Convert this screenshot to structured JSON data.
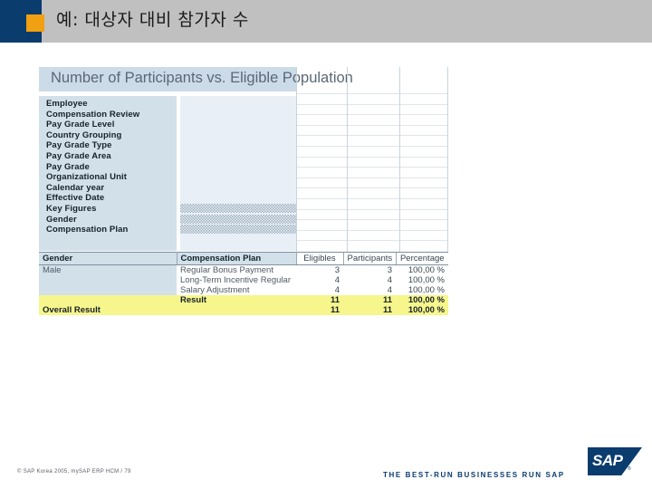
{
  "slide": {
    "title": "예: 대상자 대비 참가자 수",
    "accent_blue": "#0a3c6e",
    "accent_orange": "#f0a010",
    "header_bg": "#c0c0c0"
  },
  "report": {
    "title": "Number of Participants vs. Eligible Population",
    "filters": [
      {
        "label": "Employee",
        "hatched": false
      },
      {
        "label": "Compensation Review",
        "hatched": false
      },
      {
        "label": "Pay Grade Level",
        "hatched": false
      },
      {
        "label": "Country Grouping",
        "hatched": false
      },
      {
        "label": "Pay Grade Type",
        "hatched": false
      },
      {
        "label": "Pay Grade Area",
        "hatched": false
      },
      {
        "label": "Pay Grade",
        "hatched": false
      },
      {
        "label": "Organizational Unit",
        "hatched": false
      },
      {
        "label": "Calendar year",
        "hatched": false
      },
      {
        "label": "Effective Date",
        "hatched": false
      },
      {
        "label": "Key Figures",
        "hatched": true
      },
      {
        "label": "Gender",
        "hatched": true
      },
      {
        "label": "Compensation Plan",
        "hatched": true
      }
    ]
  },
  "table": {
    "headers": [
      "Gender",
      "Compensation Plan",
      "Eligibles",
      "Participants",
      "Percentage"
    ],
    "rows": [
      {
        "gender": "Male",
        "plan": "Regular Bonus Payment",
        "eligibles": "3",
        "participants": "3",
        "percentage": "100,00 %",
        "style": "data"
      },
      {
        "gender": "",
        "plan": "Long-Term Incentive Regular",
        "eligibles": "4",
        "participants": "4",
        "percentage": "100,00 %",
        "style": "data"
      },
      {
        "gender": "",
        "plan": "Salary Adjustment",
        "eligibles": "4",
        "participants": "4",
        "percentage": "100,00 %",
        "style": "data"
      },
      {
        "gender": "",
        "plan": "Result",
        "eligibles": "11",
        "participants": "11",
        "percentage": "100,00 %",
        "style": "result"
      },
      {
        "gender": "Overall Result",
        "plan": "",
        "eligibles": "11",
        "participants": "11",
        "percentage": "100,00 %",
        "style": "overall"
      }
    ],
    "highlight_color": "#f6f68c"
  },
  "footer": {
    "copyright": "©  SAP Korea 2005,  mySAP ERP HCM / 79",
    "tagline": "THE BEST-RUN BUSINESSES RUN SAP",
    "logo_text": "SAP",
    "logo_registered": "®"
  }
}
